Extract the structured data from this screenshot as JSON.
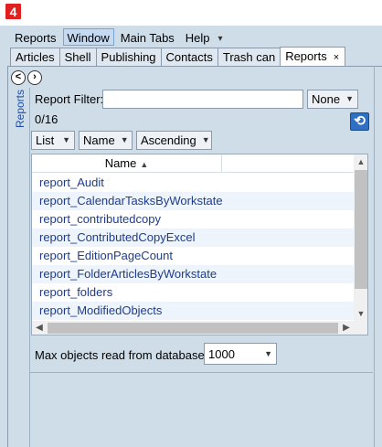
{
  "app": {
    "icon_text": "4"
  },
  "menu": {
    "items": [
      "Reports",
      "Window",
      "Main Tabs",
      "Help"
    ],
    "overflow_icon": "chevron-down-icon"
  },
  "tabs": {
    "items": [
      "Articles",
      "Shell",
      "Publishing",
      "Contacts",
      "Trash can"
    ],
    "selected": "Reports",
    "close_glyph": "×"
  },
  "panel": {
    "side_label": "Reports",
    "back_glyph": "<",
    "forward_glyph": "›"
  },
  "filter": {
    "label": "Report Filter:",
    "value": "",
    "mode": "None",
    "count": "0/16",
    "refresh_icon": "refresh-icon"
  },
  "view": {
    "layout": "List",
    "sort_field": "Name",
    "sort_order": "Ascending"
  },
  "grid": {
    "columns": [
      "Name"
    ],
    "rows": [
      "report_Audit",
      "report_CalendarTasksByWorkstate",
      "report_contributedcopy",
      "report_ContributedCopyExcel",
      "report_EditionPageCount",
      "report_FolderArticlesByWorkstate",
      "report_folders",
      "report_ModifiedObjects"
    ]
  },
  "max_objects": {
    "label": "Max objects read from database:",
    "value": "1000"
  },
  "colors": {
    "accent": "#2f6fc4",
    "link_text": "#1e3c8c",
    "background": "#cfdde8",
    "app_icon": "#e01f1f"
  }
}
